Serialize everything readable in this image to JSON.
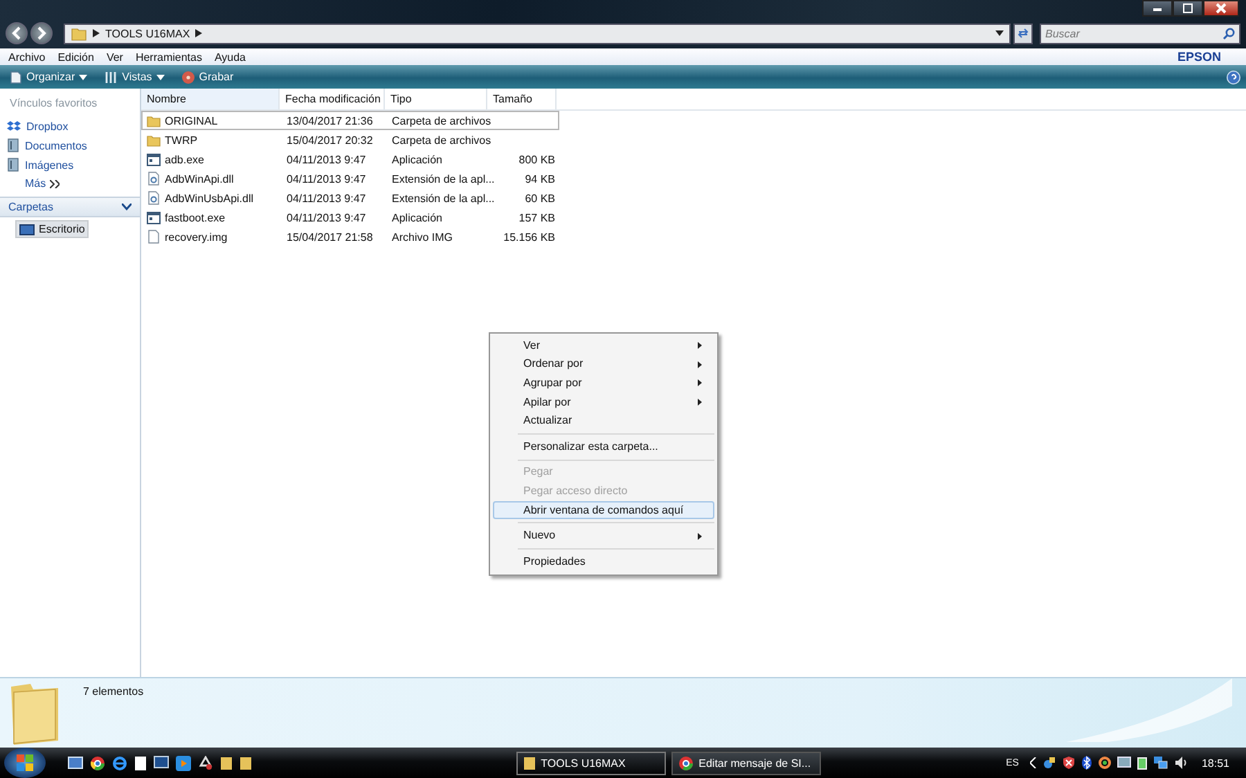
{
  "window": {
    "address": [
      "TOOLS U16MAX"
    ],
    "search": {
      "placeholder": "Buscar"
    }
  },
  "menu_bar": [
    "Archivo",
    "Edición",
    "Ver",
    "Herramientas",
    "Ayuda"
  ],
  "brand": "EPSON",
  "toolbar": [
    {
      "label": "Organizar",
      "kind": "organize",
      "dropdown": true
    },
    {
      "label": "Vistas",
      "kind": "views",
      "dropdown": true
    },
    {
      "label": "Grabar",
      "kind": "burn",
      "dropdown": false
    }
  ],
  "sidebar": {
    "favorites_title": "Vínculos favoritos",
    "favorites": [
      {
        "label": "Dropbox",
        "kind": "dropbox"
      },
      {
        "label": "Documentos",
        "kind": "docs"
      },
      {
        "label": "Imágenes",
        "kind": "docs"
      }
    ],
    "more": "Más",
    "folders_title": "Carpetas",
    "folders": [
      {
        "label": "Escritorio",
        "selected": true
      }
    ]
  },
  "table": {
    "columns": [
      "Nombre",
      "Fecha modificación",
      "Tipo",
      "Tamaño"
    ],
    "rows": [
      {
        "kind": "folder",
        "name": "ORIGINAL",
        "date": "13/04/2017 21:36",
        "type": "Carpeta de archivos",
        "size": "",
        "selected": true
      },
      {
        "kind": "folder",
        "name": "TWRP",
        "date": "15/04/2017 20:32",
        "type": "Carpeta de archivos",
        "size": "",
        "selected": false
      },
      {
        "kind": "exe",
        "name": "adb.exe",
        "date": "04/11/2013 9:47",
        "type": "Aplicación",
        "size": "800 KB",
        "selected": false
      },
      {
        "kind": "dll",
        "name": "AdbWinApi.dll",
        "date": "04/11/2013 9:47",
        "type": "Extensión de la apl...",
        "size": "94 KB",
        "selected": false
      },
      {
        "kind": "dll",
        "name": "AdbWinUsbApi.dll",
        "date": "04/11/2013 9:47",
        "type": "Extensión de la apl...",
        "size": "60 KB",
        "selected": false
      },
      {
        "kind": "exe",
        "name": "fastboot.exe",
        "date": "04/11/2013 9:47",
        "type": "Aplicación",
        "size": "157 KB",
        "selected": false
      },
      {
        "kind": "file",
        "name": "recovery.img",
        "date": "15/04/2017 21:58",
        "type": "Archivo IMG",
        "size": "15.156 KB",
        "selected": false
      }
    ]
  },
  "context_menu": [
    {
      "kind": "item",
      "label": "Ver",
      "submenu": true,
      "disabled": false,
      "selected": false
    },
    {
      "kind": "item",
      "label": "Ordenar por",
      "submenu": true,
      "disabled": false,
      "selected": false
    },
    {
      "kind": "item",
      "label": "Agrupar por",
      "submenu": true,
      "disabled": false,
      "selected": false
    },
    {
      "kind": "item",
      "label": "Apilar por",
      "submenu": true,
      "disabled": false,
      "selected": false
    },
    {
      "kind": "item",
      "label": "Actualizar",
      "submenu": false,
      "disabled": false,
      "selected": false
    },
    {
      "kind": "separator"
    },
    {
      "kind": "item",
      "label": "Personalizar esta carpeta...",
      "submenu": false,
      "disabled": false,
      "selected": false
    },
    {
      "kind": "separator"
    },
    {
      "kind": "item",
      "label": "Pegar",
      "submenu": false,
      "disabled": true,
      "selected": false
    },
    {
      "kind": "item",
      "label": "Pegar acceso directo",
      "submenu": false,
      "disabled": true,
      "selected": false
    },
    {
      "kind": "item",
      "label": "Abrir ventana de comandos aquí",
      "submenu": false,
      "disabled": false,
      "selected": true
    },
    {
      "kind": "separator"
    },
    {
      "kind": "item",
      "label": "Nuevo",
      "submenu": true,
      "disabled": false,
      "selected": false
    },
    {
      "kind": "separator"
    },
    {
      "kind": "item",
      "label": "Propiedades",
      "submenu": false,
      "disabled": false,
      "selected": false
    }
  ],
  "details": {
    "count": "7 elementos"
  },
  "taskbar": {
    "windows": [
      {
        "label": "TOOLS U16MAX",
        "kind": "folder",
        "selected": true
      },
      {
        "label": "Editar mensaje de SI...",
        "kind": "browser",
        "selected": false
      }
    ],
    "language": "ES",
    "clock": "18:51"
  }
}
